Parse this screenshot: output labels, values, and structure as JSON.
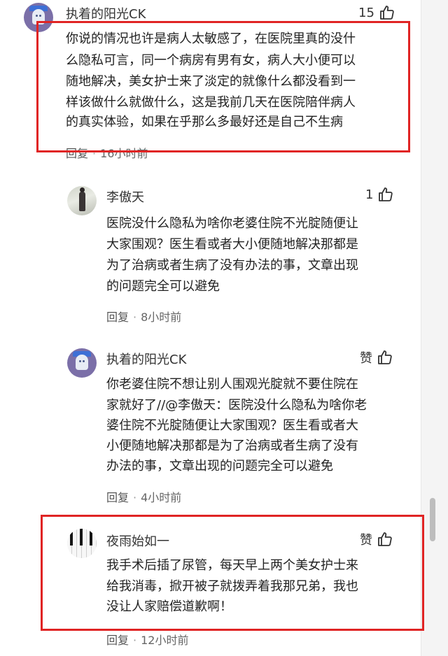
{
  "comments": [
    {
      "user": "执着的阳光CK",
      "likes": "15",
      "lines": [
        "你说的情况也许是病人太敏感了，在医院里真的没什",
        "么隐私可言，同一个病房有男有女，病人大小便可以",
        "随地解决，美女护士来了淡定的就像什么都没看到一",
        "样该做什么就做什么，这是我前几天在医院陪伴病人",
        "的真实体验，如果在乎那么多最好还是自己不生病"
      ],
      "reply": "回复",
      "time": "16小时前"
    },
    {
      "user": "李傲天",
      "likes": "1",
      "lines": [
        "医院没什么隐私为啥你老婆住院不光腚随便让",
        "大家围观？医生看或者大小便随地解决那都是",
        "为了治病或者生病了没有办法的事，文章出现",
        "的问题完全可以避免"
      ],
      "reply": "回复",
      "time": "8小时前"
    },
    {
      "user": "执着的阳光CK",
      "likes": "赞",
      "lines": [
        "你老婆住院不想让别人围观光腚就不要住院在",
        "家就好了//@李傲天：医院没什么隐私为啥你老",
        "婆住院不光腚随便让大家围观？医生看或者大",
        "小便随地解决那都是为了治病或者生病了没有",
        "办法的事，文章出现的问题完全可以避免"
      ],
      "reply": "回复",
      "time": "4小时前"
    },
    {
      "user": "夜雨始如一",
      "likes": "赞",
      "lines": [
        "我手术后插了尿管，每天早上两个美女护士来",
        "给我消毒，掀开被子就拨弄着我那兄弟，我也",
        "没让人家赔偿道歉啊！"
      ],
      "reply": "回复",
      "time": "12小时前"
    }
  ],
  "icons": {
    "thumb": "thumbs-up-icon"
  },
  "colors": {
    "highlight": "#e02424"
  }
}
